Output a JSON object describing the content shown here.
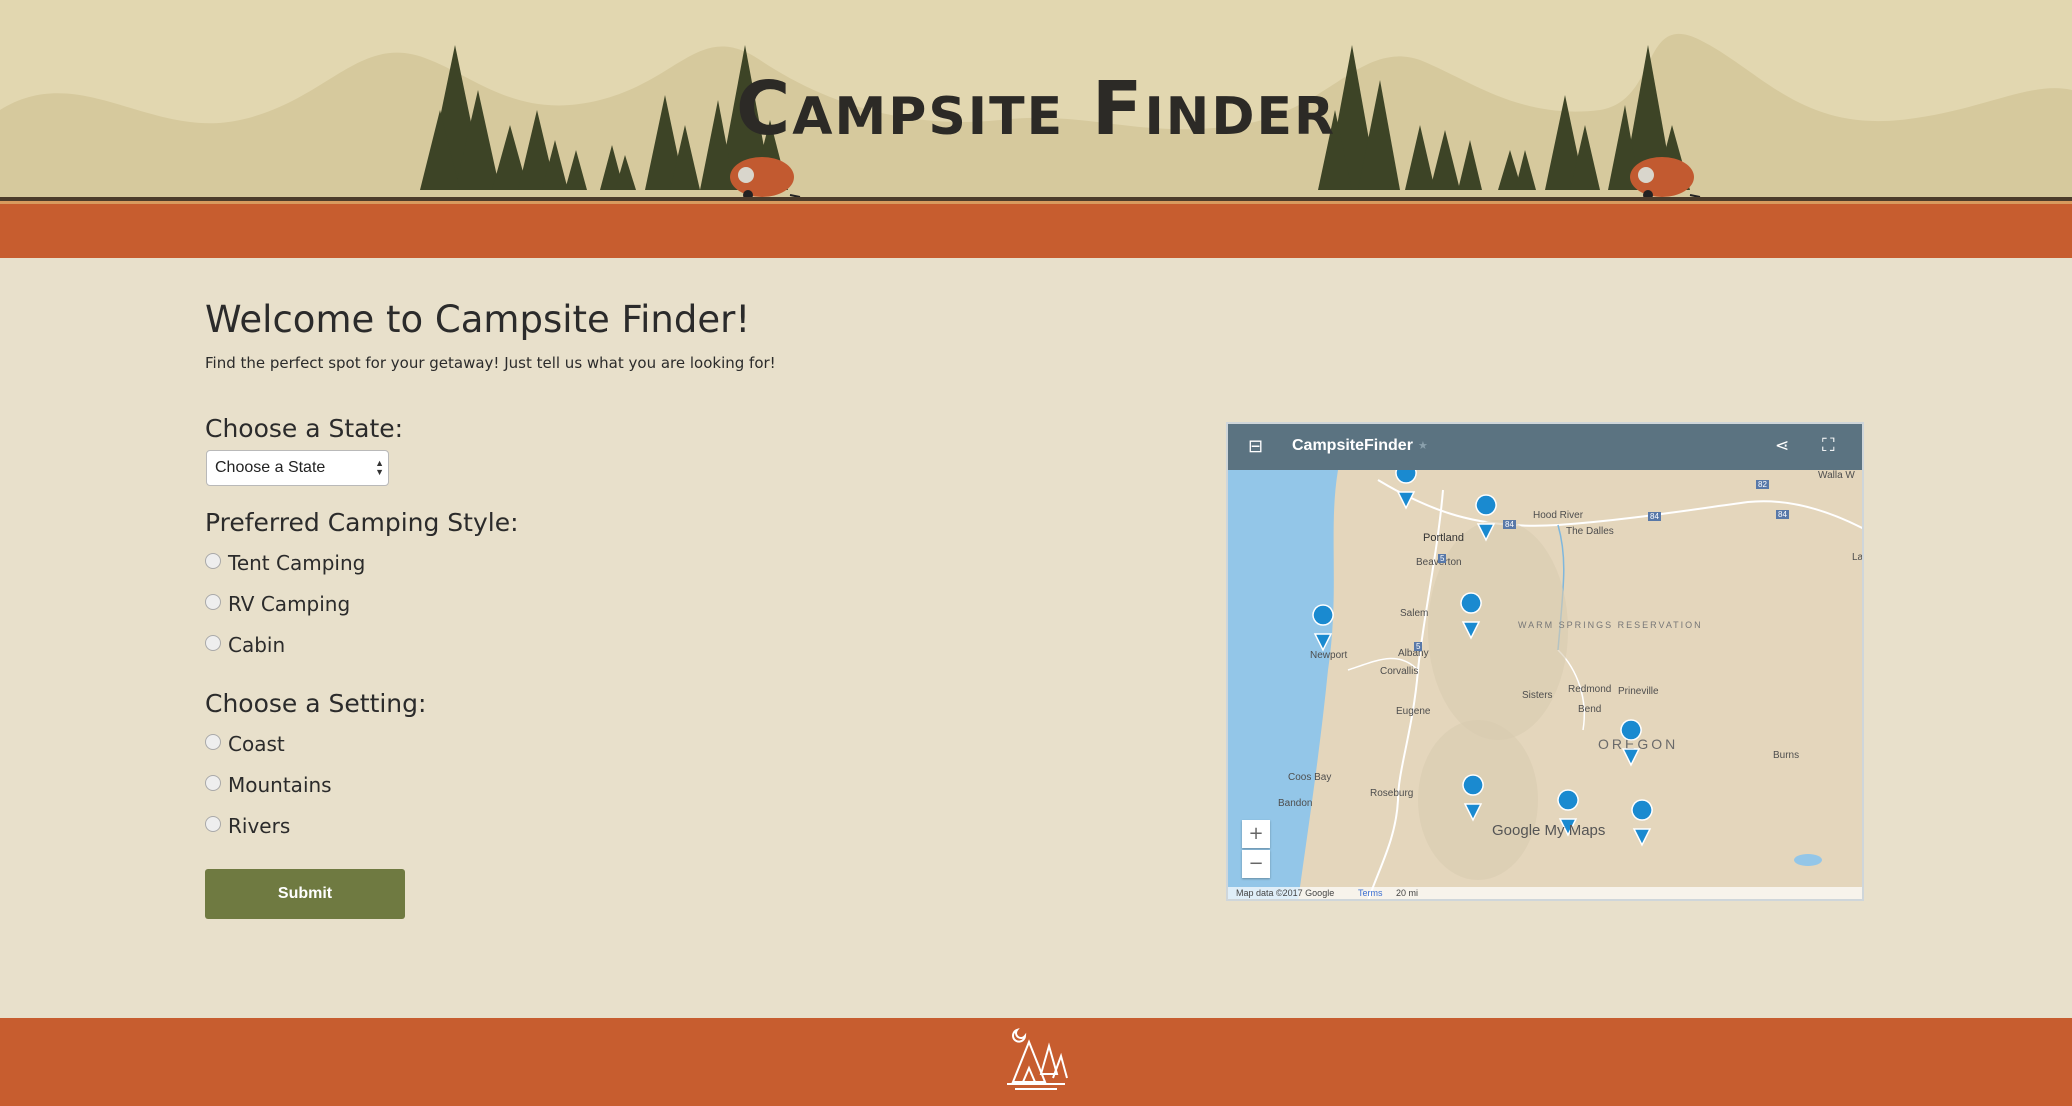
{
  "header": {
    "title": "Campsite Finder"
  },
  "main": {
    "welcome": "Welcome to Campsite Finder!",
    "tagline": "Find the perfect spot for your getaway! Just tell us what you are looking for!",
    "state": {
      "label": "Choose a State:",
      "selected": "Choose a State"
    },
    "style": {
      "label": "Preferred Camping Style:",
      "options": [
        "Tent Camping",
        "RV Camping",
        "Cabin"
      ]
    },
    "setting": {
      "label": "Choose a Setting:",
      "options": [
        "Coast",
        "Mountains",
        "Rivers"
      ]
    },
    "submit_label": "Submit"
  },
  "map": {
    "title": "CampsiteFinder",
    "region_label": "OREGON",
    "reservation_label": "WARM SPRINGS RESERVATION",
    "cities": [
      "Portland",
      "Beaverton",
      "Salem",
      "Albany",
      "Corvallis",
      "Eugene",
      "Newport",
      "Coos Bay",
      "Bandon",
      "Roseburg",
      "Hood River",
      "The Dalles",
      "Sisters",
      "Redmond",
      "Prineville",
      "Bend",
      "Burns",
      "La",
      "Walla W"
    ],
    "zoom_in": "+",
    "zoom_out": "−",
    "attribution": "Map data ©2017 Google",
    "terms": "Terms",
    "scale": "20 mi",
    "brand": "Google My Maps",
    "highway_labels": [
      "84",
      "84",
      "84",
      "82",
      "5",
      "5"
    ]
  },
  "colors": {
    "header_bg": "#e2d7b0",
    "header_stripe": "#c75d2f",
    "page_bg": "#e8e0cb",
    "button": "#6f7a41",
    "map_bar": "#5b7381",
    "pin": "#1a8ad0",
    "footer": "#c75d2f"
  }
}
